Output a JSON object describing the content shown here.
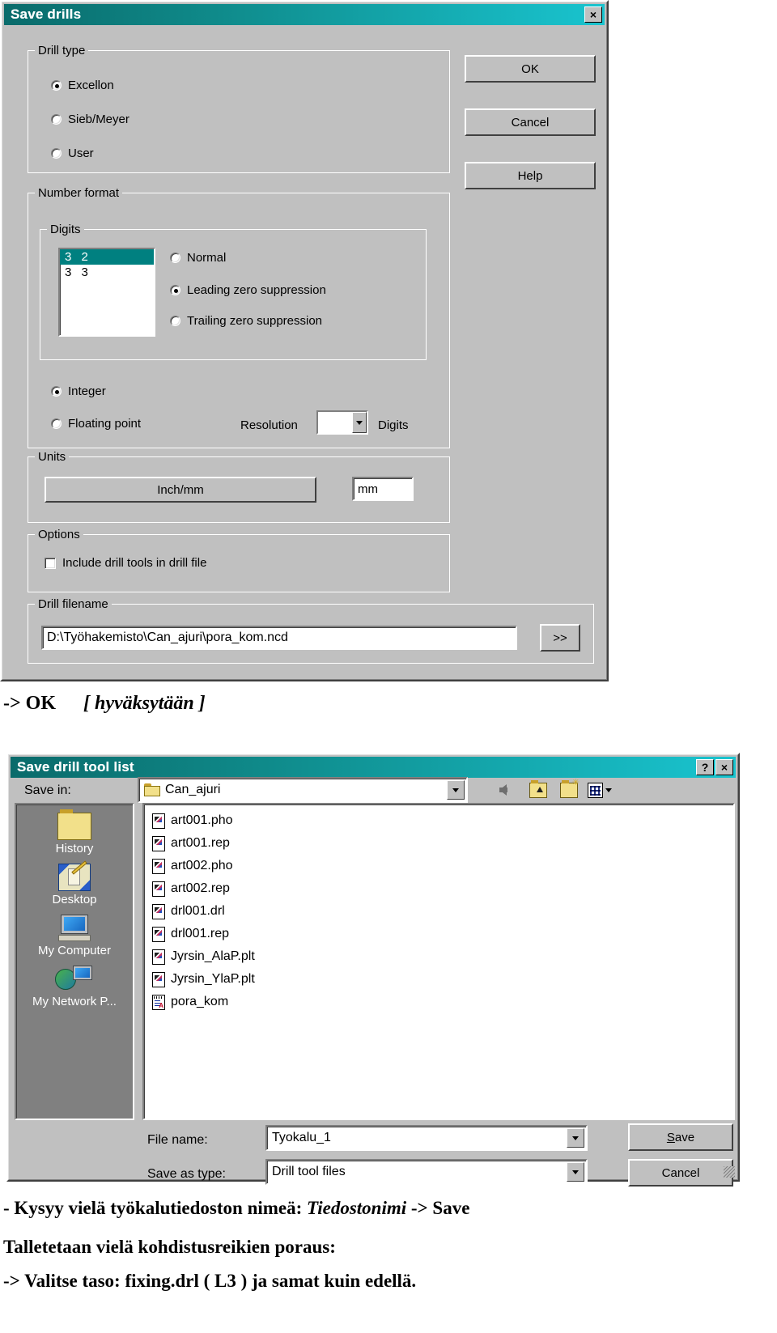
{
  "dialog_save_drills": {
    "title": "Save drills",
    "close_label": "×",
    "buttons": {
      "ok": "OK",
      "cancel": "Cancel",
      "help": "Help"
    },
    "drill_type": {
      "legend": "Drill type",
      "options": [
        {
          "label": "Excellon",
          "selected": true
        },
        {
          "label": "Sieb/Meyer",
          "selected": false
        },
        {
          "label": "User",
          "selected": false
        }
      ]
    },
    "number_format": {
      "legend": "Number format",
      "digits": {
        "legend": "Digits",
        "list": [
          {
            "value": "3 2",
            "selected": true
          },
          {
            "value": "3 3",
            "selected": false
          }
        ],
        "zero_options": [
          {
            "label": "Normal",
            "selected": false
          },
          {
            "label": "Leading zero suppression",
            "selected": true
          },
          {
            "label": "Trailing zero suppression",
            "selected": false
          }
        ]
      },
      "value_type": [
        {
          "label": "Integer",
          "selected": true
        },
        {
          "label": "Floating point",
          "selected": false
        }
      ],
      "resolution_label": "Resolution",
      "resolution_value": "",
      "digits_suffix": "Digits"
    },
    "units": {
      "legend": "Units",
      "button_label": "Inch/mm",
      "value": "mm"
    },
    "options": {
      "legend": "Options",
      "checkbox_label": "Include drill tools in drill file",
      "checked": false
    },
    "drill_filename": {
      "legend": "Drill filename",
      "value": "D:\\Työhakemisto\\Can_ajuri\\pora_kom.ncd",
      "browse_label": ">>"
    }
  },
  "step_note": {
    "prefix": "-> OK",
    "bracket": "[ hyväksytään ]"
  },
  "dialog_tool_list": {
    "title": "Save drill tool list",
    "help_label": "?",
    "close_label": "×",
    "save_in": {
      "label": "Save in:",
      "value": "Can_ajuri",
      "icon": "folder-icon"
    },
    "toolbar_icons": [
      "back-arrow-icon",
      "up-one-level-icon",
      "create-new-folder-icon",
      "views-menu-icon"
    ],
    "places": [
      {
        "label": "History",
        "icon": "history-folder-icon"
      },
      {
        "label": "Desktop",
        "icon": "desktop-icon"
      },
      {
        "label": "My Computer",
        "icon": "my-computer-icon"
      },
      {
        "label": "My Network P...",
        "icon": "my-network-places-icon"
      }
    ],
    "files": [
      {
        "name": "art001.pho",
        "icon": "generic-file-icon"
      },
      {
        "name": "art001.rep",
        "icon": "generic-file-icon"
      },
      {
        "name": "art002.pho",
        "icon": "generic-file-icon"
      },
      {
        "name": "art002.rep",
        "icon": "generic-file-icon"
      },
      {
        "name": "drl001.drl",
        "icon": "generic-file-icon"
      },
      {
        "name": "drl001.rep",
        "icon": "generic-file-icon"
      },
      {
        "name": "Jyrsin_AlaP.plt",
        "icon": "generic-file-icon"
      },
      {
        "name": "Jyrsin_YlaP.plt",
        "icon": "generic-file-icon"
      },
      {
        "name": "pora_kom",
        "icon": "notepad-file-icon"
      }
    ],
    "file_name": {
      "label": "File name:",
      "value": "Tyokalu_1"
    },
    "save_as_type": {
      "label": "Save as type:",
      "value": "Drill tool files"
    },
    "buttons": {
      "save": "Save",
      "cancel": "Cancel"
    }
  },
  "footer": {
    "line1_a": "- Kysyy vielä työkalutiedoston nimeä: ",
    "line1_b": "Tiedostonimi",
    "line1_c": " -> Save",
    "line2": "Talletetaan vielä kohdistusreikien poraus:",
    "line3": "-> Valitse taso:  fixing.drl ( L3 )  ja samat kuin edellä."
  },
  "colors": {
    "title_gradient_start": "#0a6b6b",
    "title_gradient_end": "#19c4cf",
    "dialog_face": "#c0c0c0",
    "selection": "#008080",
    "places_bar": "#808080"
  }
}
